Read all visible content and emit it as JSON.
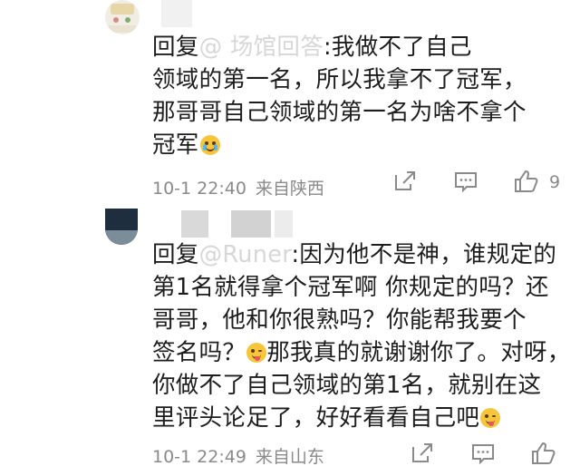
{
  "comments": [
    {
      "reply_prefix": "回复",
      "mention": "@ 场馆回答",
      "text_lines": [
        ":我做不了自己",
        "领域的第一名，所以我拿不了冠军，",
        "那哥哥自己领域的第一名为啥不拿个",
        "冠军"
      ],
      "timestamp": "10-1 22:40",
      "location": "来自陕西",
      "like_count": "9"
    },
    {
      "reply_prefix": "回复",
      "mention": "@Runer",
      "text_lines": [
        ":因为他不是神，谁规定的",
        "第1名就得拿个冠军啊 你规定的吗？还",
        "哥哥，他和你很熟吗？你能帮我要个",
        "签名吗？",
        "那我真的就谢谢你了。对呀，",
        "你做不了自己领域的第1名，就别在这",
        "里评头论足了，好好看看自己吧"
      ],
      "timestamp": "10-1 22:49",
      "location": "来自山东",
      "like_count": ""
    }
  ],
  "icons": {
    "share": "share-icon",
    "comment": "comment-icon",
    "like": "thumbs-up-icon",
    "emoji_crying": "crying-face-emoji-icon",
    "emoji_tongue": "winking-tongue-emoji-icon"
  },
  "colors": {
    "text": "#1d1d1d",
    "meta": "#8a8a8a",
    "icon": "#8a8a8a"
  }
}
